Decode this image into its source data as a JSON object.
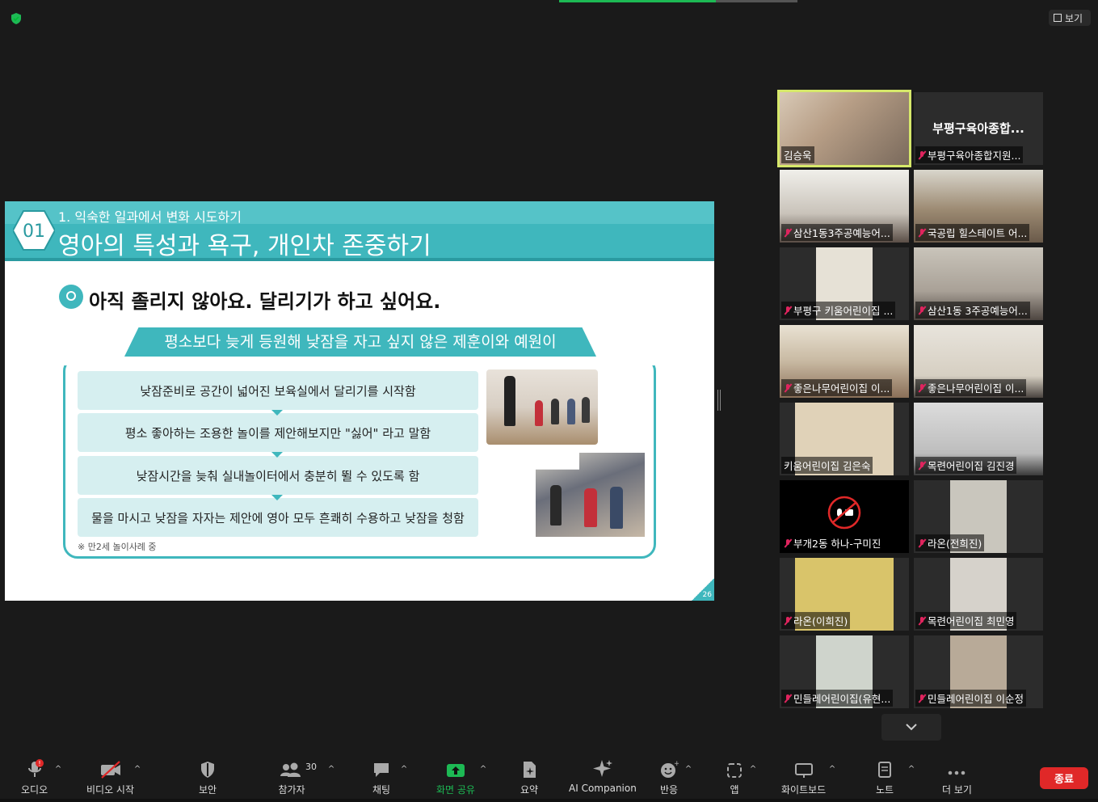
{
  "topbar": {
    "view_label": "보기"
  },
  "slide": {
    "num": "01",
    "subtitle": "1. 익숙한 일과에서 변화 시도하기",
    "title": "영아의 특성과 욕구, 개인차 존중하기",
    "headline": "아직 졸리지 않아요. 달리기가 하고 싶어요.",
    "banner": "평소보다 늦게 등원해 낮잠을 자고 싶지 않은 제훈이와 예원이",
    "steps": [
      "낮잠준비로 공간이 넓어진 보육실에서 달리기를 시작함",
      "평소 좋아하는 조용한 놀이를 제안해보지만 \"싫어\" 라고 말함",
      "낮잠시간을 늦춰 실내놀이터에서 충분히 뛸 수 있도록 함",
      "물을 마시고 낮잠을 자자는 제안에 영아 모두 흔쾌히 수용하고 낮잠을 청함"
    ],
    "note": "※ 만2세 놀이사례 중",
    "page": "26"
  },
  "gallery": {
    "participants": [
      {
        "name": "김승욱",
        "muted": false,
        "active": true
      },
      {
        "name": "부평구육아종합지원...",
        "big": "부평구육아종합...",
        "muted": true
      },
      {
        "name": "삼산1동3주공예능어...",
        "muted": true
      },
      {
        "name": "국공립 힐스테이트 어...",
        "muted": true
      },
      {
        "name": "부평구 키움어린이집 ...",
        "muted": true
      },
      {
        "name": "삼산1동 3주공예능어...",
        "muted": true
      },
      {
        "name": "좋은나무어린이집 이...",
        "muted": true
      },
      {
        "name": "좋은나무어린이집 이...",
        "muted": true
      },
      {
        "name": "키움어린이집 김은숙",
        "muted": false
      },
      {
        "name": "목련어린이집 김진경",
        "muted": true
      },
      {
        "name": "부개2동 하나-구미진",
        "muted": true
      },
      {
        "name": "라온(전희진)",
        "muted": true
      },
      {
        "name": "라온(이희진)",
        "muted": true
      },
      {
        "name": "목련어린이집 최민영",
        "muted": true
      },
      {
        "name": "민들레어린이집(유현...",
        "muted": true
      },
      {
        "name": "민들레어린이집 이순정",
        "muted": true
      }
    ]
  },
  "toolbar": {
    "audio": "오디오",
    "video": "비디오 시작",
    "security": "보안",
    "participants": "참가자",
    "participants_count": "30",
    "chat": "채팅",
    "share": "화면 공유",
    "summary": "요약",
    "ai": "AI Companion",
    "reactions": "반응",
    "apps": "앱",
    "whiteboard": "화이트보드",
    "notes": "노트",
    "more": "더 보기",
    "end": "종료"
  },
  "colors": {
    "accent": "#3fb7bd",
    "share_green": "#1db954",
    "end_red": "#e02828",
    "active_outline": "#d6e86a"
  }
}
